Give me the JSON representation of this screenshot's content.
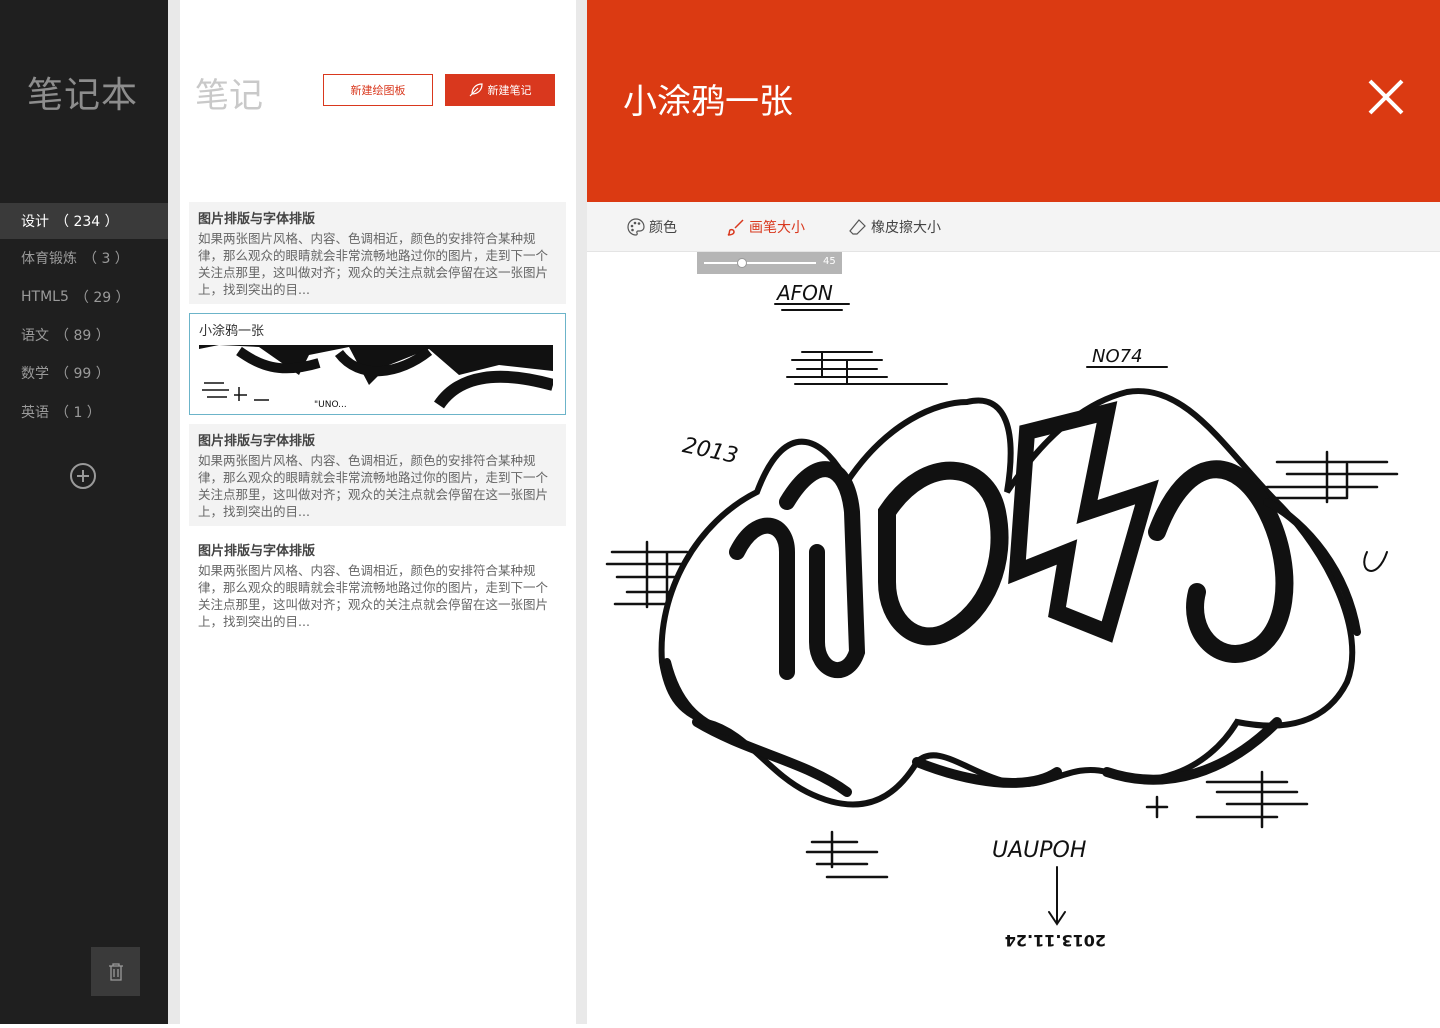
{
  "sidebar": {
    "title": "笔记本",
    "categories": [
      {
        "label": "设计",
        "count": "（ 234 ）"
      },
      {
        "label": "体育锻炼",
        "count": "（ 3 ）"
      },
      {
        "label": "HTML5",
        "count": "（ 29 ）"
      },
      {
        "label": "语文",
        "count": "（ 89 ）"
      },
      {
        "label": "数学",
        "count": "（ 99 ）"
      },
      {
        "label": "英语",
        "count": "（ 1 ）"
      }
    ],
    "add_icon": "plus-circle-icon",
    "trash_icon": "trash-icon"
  },
  "notes": {
    "title": "笔记",
    "new_board_label": "新建绘图板",
    "new_note_label": "新建笔记",
    "items": [
      {
        "title": "图片排版与字体排版",
        "body": "如果两张图片风格、内容、色调相近，颜色的安排符合某种规律，那么观众的眼睛就会非常流畅地路过你的图片，走到下一个关注点那里，这叫做对齐；观众的关注点就会停留在这一张图片上，找到突出的目..."
      },
      {
        "title": "小涂鸦一张"
      },
      {
        "title": "图片排版与字体排版",
        "body": "如果两张图片风格、内容、色调相近，颜色的安排符合某种规律，那么观众的眼睛就会非常流畅地路过你的图片，走到下一个关注点那里，这叫做对齐；观众的关注点就会停留在这一张图片上，找到突出的目..."
      },
      {
        "title": "图片排版与字体排版",
        "body": "如果两张图片风格、内容、色调相近，颜色的安排符合某种规律，那么观众的眼睛就会非常流畅地路过你的图片，走到下一个关注点那里，这叫做对齐；观众的关注点就会停留在这一张图片上，找到突出的目..."
      }
    ]
  },
  "editor": {
    "title": "小涂鸦一张",
    "accent": "#db3a12",
    "tools": {
      "color": "颜色",
      "brush_size": "画笔大小",
      "eraser_size": "橡皮擦大小"
    },
    "brush_value": "45",
    "graffiti_texts": {
      "tag1": "AFON",
      "tag2": "NO74",
      "year": "2013",
      "signature": "UAUPOH",
      "date": "2013.11.24"
    }
  }
}
